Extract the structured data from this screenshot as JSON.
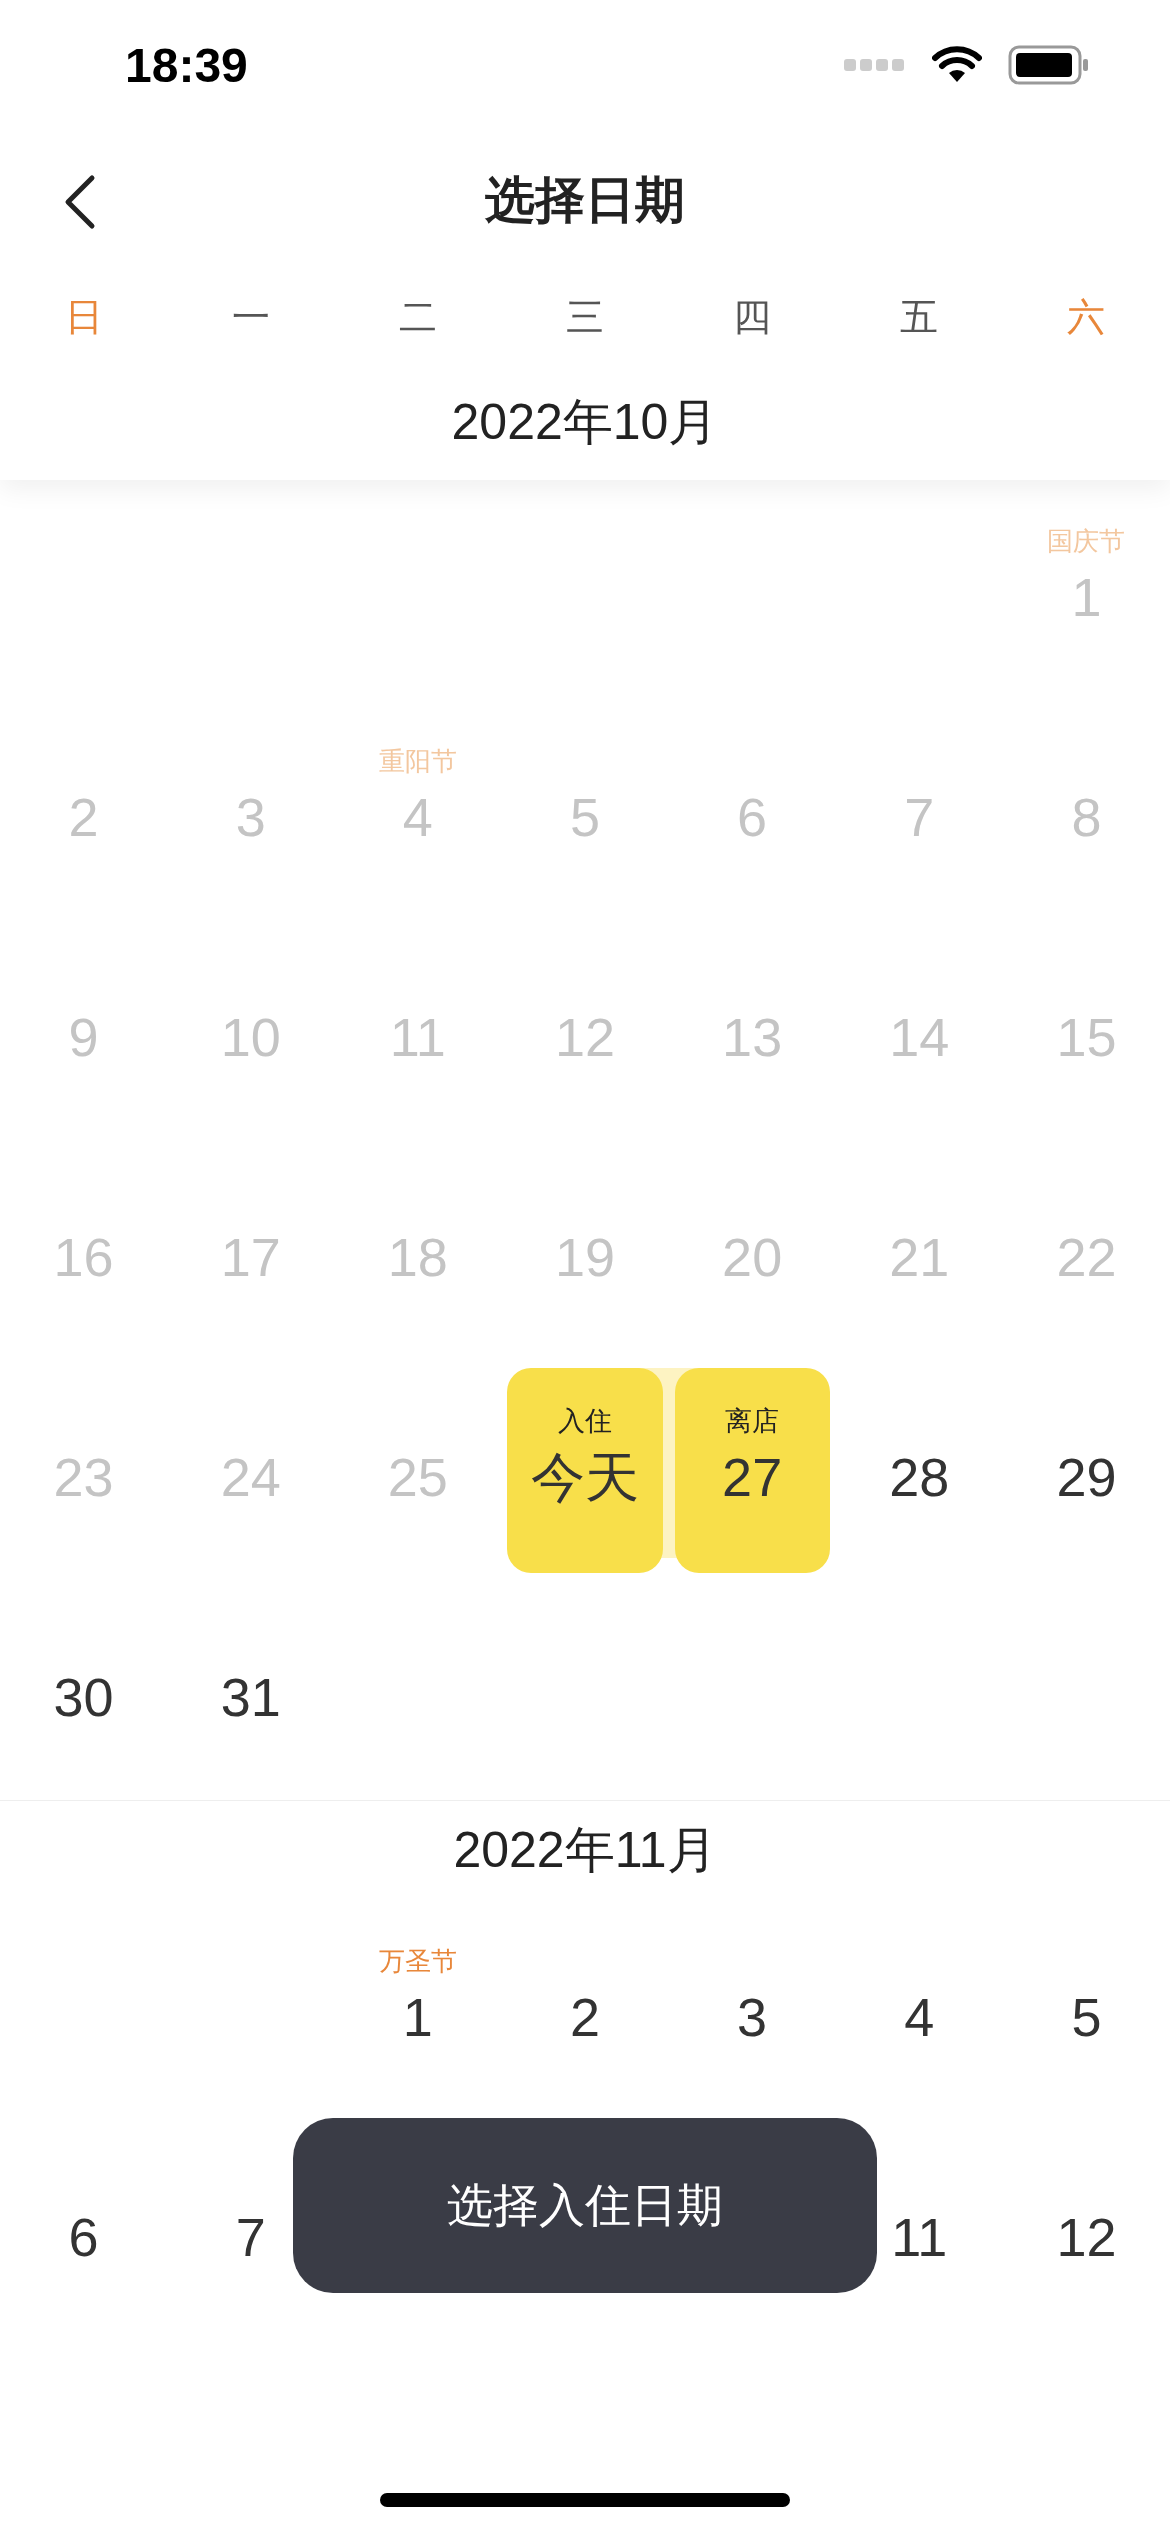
{
  "status_bar": {
    "time": "18:39"
  },
  "nav": {
    "title": "选择日期"
  },
  "weekdays": [
    {
      "label": "日",
      "weekend": true
    },
    {
      "label": "一",
      "weekend": false
    },
    {
      "label": "二",
      "weekend": false
    },
    {
      "label": "三",
      "weekend": false
    },
    {
      "label": "四",
      "weekend": false
    },
    {
      "label": "五",
      "weekend": false
    },
    {
      "label": "六",
      "weekend": true
    }
  ],
  "months": [
    {
      "title": "2022年10月",
      "days": [
        {
          "kind": "empty"
        },
        {
          "kind": "empty"
        },
        {
          "kind": "empty"
        },
        {
          "kind": "empty"
        },
        {
          "kind": "empty"
        },
        {
          "kind": "empty"
        },
        {
          "kind": "day",
          "text": "1",
          "note": "国庆节",
          "disabled": true,
          "selected": false
        },
        {
          "kind": "day",
          "text": "2",
          "disabled": true,
          "selected": false
        },
        {
          "kind": "day",
          "text": "3",
          "disabled": true,
          "selected": false
        },
        {
          "kind": "day",
          "text": "4",
          "note": "重阳节",
          "disabled": true,
          "selected": false
        },
        {
          "kind": "day",
          "text": "5",
          "disabled": true,
          "selected": false
        },
        {
          "kind": "day",
          "text": "6",
          "disabled": true,
          "selected": false
        },
        {
          "kind": "day",
          "text": "7",
          "disabled": true,
          "selected": false
        },
        {
          "kind": "day",
          "text": "8",
          "disabled": true,
          "selected": false
        },
        {
          "kind": "day",
          "text": "9",
          "disabled": true,
          "selected": false
        },
        {
          "kind": "day",
          "text": "10",
          "disabled": true,
          "selected": false
        },
        {
          "kind": "day",
          "text": "11",
          "disabled": true,
          "selected": false
        },
        {
          "kind": "day",
          "text": "12",
          "disabled": true,
          "selected": false
        },
        {
          "kind": "day",
          "text": "13",
          "disabled": true,
          "selected": false
        },
        {
          "kind": "day",
          "text": "14",
          "disabled": true,
          "selected": false
        },
        {
          "kind": "day",
          "text": "15",
          "disabled": true,
          "selected": false
        },
        {
          "kind": "day",
          "text": "16",
          "disabled": true,
          "selected": false
        },
        {
          "kind": "day",
          "text": "17",
          "disabled": true,
          "selected": false
        },
        {
          "kind": "day",
          "text": "18",
          "disabled": true,
          "selected": false
        },
        {
          "kind": "day",
          "text": "19",
          "disabled": true,
          "selected": false
        },
        {
          "kind": "day",
          "text": "20",
          "disabled": true,
          "selected": false
        },
        {
          "kind": "day",
          "text": "21",
          "disabled": true,
          "selected": false
        },
        {
          "kind": "day",
          "text": "22",
          "disabled": true,
          "selected": false
        },
        {
          "kind": "day",
          "text": "23",
          "disabled": true,
          "selected": false
        },
        {
          "kind": "day",
          "text": "24",
          "disabled": true,
          "selected": false
        },
        {
          "kind": "day",
          "text": "25",
          "disabled": true,
          "selected": false
        },
        {
          "kind": "day",
          "text": "今天",
          "tag": "入住",
          "disabled": false,
          "selected": true
        },
        {
          "kind": "day",
          "text": "27",
          "tag": "离店",
          "disabled": false,
          "selected": true
        },
        {
          "kind": "day",
          "text": "28",
          "disabled": false,
          "selected": false
        },
        {
          "kind": "day",
          "text": "29",
          "disabled": false,
          "selected": false
        },
        {
          "kind": "day",
          "text": "30",
          "disabled": false,
          "selected": false
        },
        {
          "kind": "day",
          "text": "31",
          "disabled": false,
          "selected": false
        }
      ]
    },
    {
      "title": "2022年11月",
      "days": [
        {
          "kind": "empty"
        },
        {
          "kind": "empty"
        },
        {
          "kind": "day",
          "text": "1",
          "note": "万圣节",
          "disabled": false,
          "selected": false
        },
        {
          "kind": "day",
          "text": "2",
          "disabled": false,
          "selected": false
        },
        {
          "kind": "day",
          "text": "3",
          "disabled": false,
          "selected": false
        },
        {
          "kind": "day",
          "text": "4",
          "disabled": false,
          "selected": false
        },
        {
          "kind": "day",
          "text": "5",
          "disabled": false,
          "selected": false
        },
        {
          "kind": "day",
          "text": "6",
          "disabled": false,
          "selected": false
        },
        {
          "kind": "day",
          "text": "7",
          "disabled": false,
          "selected": false
        },
        {
          "kind": "empty"
        },
        {
          "kind": "empty"
        },
        {
          "kind": "empty"
        },
        {
          "kind": "day",
          "text": "11",
          "disabled": false,
          "selected": false
        },
        {
          "kind": "day",
          "text": "12",
          "disabled": false,
          "selected": false
        }
      ]
    }
  ],
  "toast": {
    "text": "选择入住日期"
  }
}
